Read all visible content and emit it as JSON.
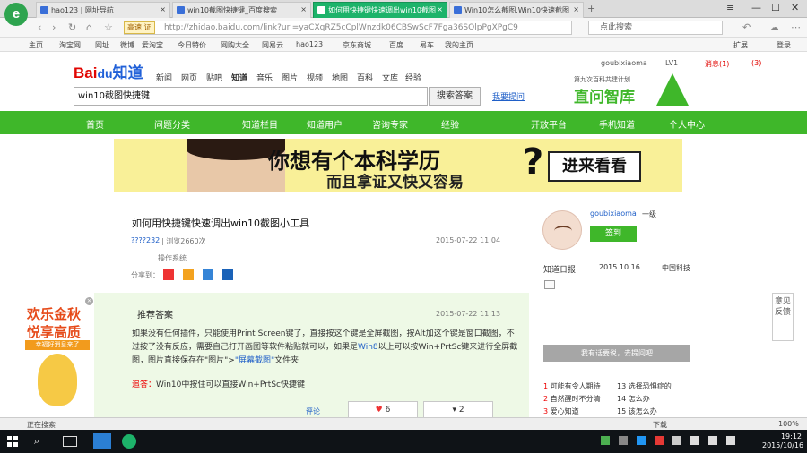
{
  "browser": {
    "tabs": [
      {
        "label": "hao123 | 网址导航"
      },
      {
        "label": "win10截图快捷键_百度搜索"
      },
      {
        "label": "如何用快捷键快速调出win10截图"
      },
      {
        "label": "Win10怎么截图,Win10快速截图"
      }
    ],
    "address": {
      "tag": "高速 证",
      "url": "http://zhidao.baidu.com/link?url=yaCXqRZ5cCplWnzdk06CBSwScF7Fga36SOlpPgXPgC9"
    },
    "search_placeholder": "点此搜索",
    "bookmarks": [
      "主页",
      "淘宝网",
      "网址",
      "微博",
      "爱淘宝",
      "今日特价",
      "网购大全",
      "网易云",
      "hao123",
      "京东商城",
      "百度",
      "易车",
      "我的主页"
    ],
    "extensions": [
      "扩展",
      "登录"
    ]
  },
  "baidu": {
    "logo_left": "Bai",
    "logo_mid": "du",
    "logo_right": "知道",
    "top_nav": [
      "新闻",
      "网页",
      "贴吧",
      "知道",
      "音乐",
      "图片",
      "视频",
      "地图",
      "百科",
      "文库",
      "经验"
    ],
    "search_value": "win10截图快捷键",
    "search_button": "搜索答案",
    "ask_link": "我要提问",
    "user": {
      "name": "goubixiaoma",
      "level": "LV1",
      "messages": "消息(1)",
      "count": "(3)"
    },
    "promo_top": "第九次百科共建计划",
    "promo_main": "直问智库"
  },
  "main_nav": [
    "首页",
    "问题分类",
    "知道栏目",
    "知道用户",
    "咨询专家",
    "经验",
    "开放平台",
    "手机知道",
    "个人中心"
  ],
  "ad": {
    "line1": "你想有个本科学历",
    "line2": "而且拿证又快又容易",
    "mark": "?",
    "button": "进来看看"
  },
  "question": {
    "title": "如何用快捷键快速调出win10截图小工具",
    "user": "????232",
    "views": "| 浏览2660次",
    "time": "2015-07-22 11:04",
    "category": "操作系统",
    "share_label": "分享到："
  },
  "answer": {
    "label": "推荐答案",
    "time": "2015-07-22 11:13",
    "text_pre": "如果没有任何插件，只能使用Print Screen键了，直接按这个键是全屏截图，按Alt加这个键是窗口截图，不过按了没有反应，需要自己打开画图等软件粘贴就可以，如果是",
    "text_link": "Win8",
    "text_post": "以上可以按Win+PrtSc键来进行全屏截图，图片直接保存在\"图片\">",
    "text_link2": "\"屏幕截图\"",
    "text_end": "文件夹",
    "comment_label": "追答：",
    "comment_text": "Win10中按住可以直接Win+PrtSc快捷键",
    "vote_label": "评论",
    "vote_up": "6",
    "vote_down": "2"
  },
  "sidebar": {
    "username": "goubixiaoma",
    "level": "一级",
    "sign_button": "签到",
    "date_label": "知道日报",
    "date": "2015.10.16",
    "more": "中国科技",
    "gray_button": "我有话要说，去提问吧",
    "rank_left": [
      "可能有令人期待",
      "自然醒时不分清",
      "爱心知道"
    ],
    "rank_right": [
      "选择恐惧症的",
      "怎么办",
      "该怎么办"
    ]
  },
  "left_ad": {
    "line1": "欢乐金秋",
    "line2": "悦享高质",
    "button": "幸福好消息来了"
  },
  "feedback": "意见反馈",
  "status": {
    "left": "正在搜索",
    "right1": "下载",
    "zoom": "100%"
  },
  "clock": {
    "time": "19:12",
    "date": "2015/10/16"
  },
  "colors": {
    "baidu_green": "#3fb72a",
    "baidu_red": "#e10602",
    "baidu_blue": "#2060d8",
    "active_tab": "#1db36a"
  }
}
